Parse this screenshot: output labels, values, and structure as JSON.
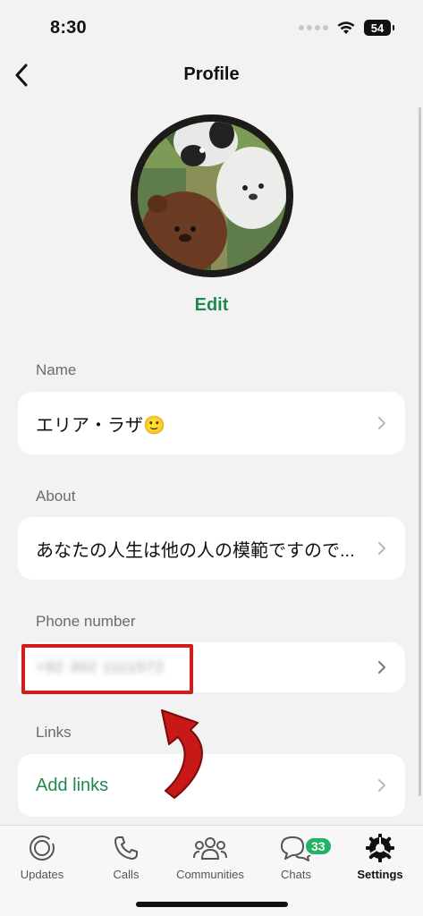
{
  "status": {
    "time": "8:30",
    "battery": "54"
  },
  "header": {
    "title": "Profile"
  },
  "profile": {
    "edit_label": "Edit"
  },
  "sections": {
    "name": {
      "label": "Name",
      "value": "エリア・ラザ🙂"
    },
    "about": {
      "label": "About",
      "value": "あなたの人生は他の人の模範ですので..."
    },
    "phone": {
      "label": "Phone number",
      "value": "+92 302 1111572"
    },
    "links": {
      "label": "Links",
      "value": "Add links"
    }
  },
  "tabs": [
    {
      "label": "Updates",
      "icon": "updates-icon"
    },
    {
      "label": "Calls",
      "icon": "phone-icon"
    },
    {
      "label": "Communities",
      "icon": "communities-icon"
    },
    {
      "label": "Chats",
      "icon": "chat-icon",
      "badge": "33"
    },
    {
      "label": "Settings",
      "icon": "gear-icon",
      "active": true
    }
  ],
  "colors": {
    "accent": "#1e8a4f",
    "badge": "#20b463",
    "annotation": "#d51d1d"
  }
}
